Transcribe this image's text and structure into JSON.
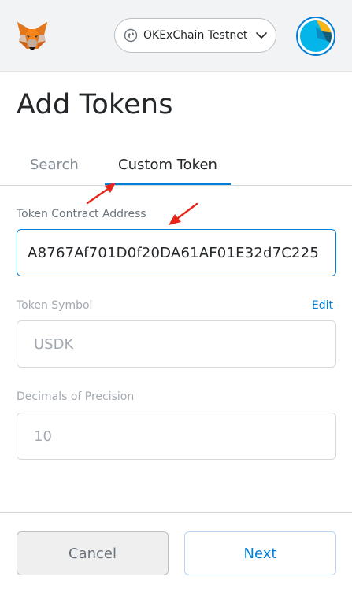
{
  "header": {
    "logo_icon": "metamask-fox-icon",
    "network": {
      "label": "OKExChain Testnet",
      "icon": "network-globe-icon",
      "chevron": "chevron-down-icon"
    },
    "account_icon": "account-identicon"
  },
  "page": {
    "title": "Add Tokens"
  },
  "tabs": [
    {
      "label": "Search",
      "active": false
    },
    {
      "label": "Custom Token",
      "active": true
    }
  ],
  "form": {
    "contract_address": {
      "label": "Token Contract Address",
      "value": "A8767Af701D0f20DA61AF01E32d7C225"
    },
    "token_symbol": {
      "label": "Token Symbol",
      "edit_label": "Edit",
      "value": "USDK"
    },
    "decimals": {
      "label": "Decimals of Precision",
      "value": "10"
    }
  },
  "footer": {
    "cancel_label": "Cancel",
    "next_label": "Next"
  },
  "colors": {
    "accent": "#037dd6",
    "annotation_arrow": "#e8261c",
    "header_bg": "#f2f3f4"
  }
}
